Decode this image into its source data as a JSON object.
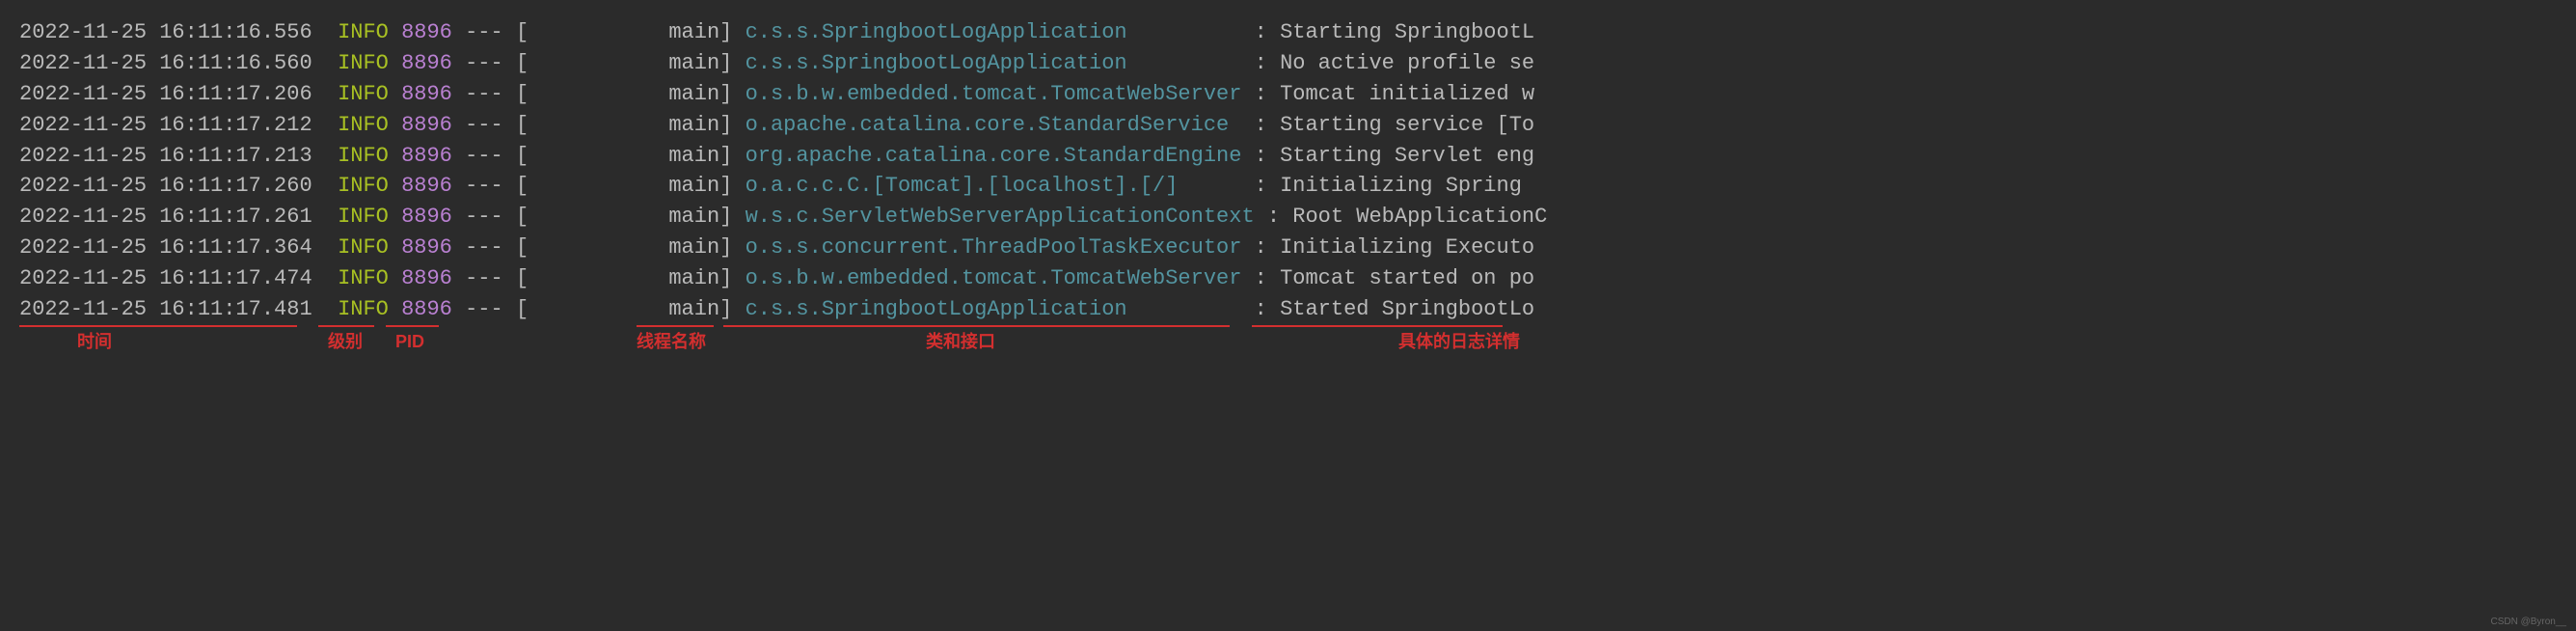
{
  "logs": [
    {
      "timestamp": "2022-11-25 16:11:16.556",
      "level": "INFO",
      "pid": "8896",
      "sep": "---",
      "thread": "main",
      "logger": "c.s.s.SpringbootLogApplication         ",
      "message": "Starting SpringbootL"
    },
    {
      "timestamp": "2022-11-25 16:11:16.560",
      "level": "INFO",
      "pid": "8896",
      "sep": "---",
      "thread": "main",
      "logger": "c.s.s.SpringbootLogApplication         ",
      "message": "No active profile se"
    },
    {
      "timestamp": "2022-11-25 16:11:17.206",
      "level": "INFO",
      "pid": "8896",
      "sep": "---",
      "thread": "main",
      "logger": "o.s.b.w.embedded.tomcat.TomcatWebServer",
      "message": "Tomcat initialized w"
    },
    {
      "timestamp": "2022-11-25 16:11:17.212",
      "level": "INFO",
      "pid": "8896",
      "sep": "---",
      "thread": "main",
      "logger": "o.apache.catalina.core.StandardService ",
      "message": "Starting service [To"
    },
    {
      "timestamp": "2022-11-25 16:11:17.213",
      "level": "INFO",
      "pid": "8896",
      "sep": "---",
      "thread": "main",
      "logger": "org.apache.catalina.core.StandardEngine",
      "message": "Starting Servlet eng"
    },
    {
      "timestamp": "2022-11-25 16:11:17.260",
      "level": "INFO",
      "pid": "8896",
      "sep": "---",
      "thread": "main",
      "logger": "o.a.c.c.C.[Tomcat].[localhost].[/]     ",
      "message": "Initializing Spring "
    },
    {
      "timestamp": "2022-11-25 16:11:17.261",
      "level": "INFO",
      "pid": "8896",
      "sep": "---",
      "thread": "main",
      "logger": "w.s.c.ServletWebServerApplicationContext",
      "message": "Root WebApplicationC"
    },
    {
      "timestamp": "2022-11-25 16:11:17.364",
      "level": "INFO",
      "pid": "8896",
      "sep": "---",
      "thread": "main",
      "logger": "o.s.s.concurrent.ThreadPoolTaskExecutor",
      "message": "Initializing Executo"
    },
    {
      "timestamp": "2022-11-25 16:11:17.474",
      "level": "INFO",
      "pid": "8896",
      "sep": "---",
      "thread": "main",
      "logger": "o.s.b.w.embedded.tomcat.TomcatWebServer",
      "message": "Tomcat started on po"
    },
    {
      "timestamp": "2022-11-25 16:11:17.481",
      "level": "INFO",
      "pid": "8896",
      "sep": "---",
      "thread": "main",
      "logger": "c.s.s.SpringbootLogApplication         ",
      "message": "Started SpringbootLo"
    }
  ],
  "annotations": {
    "time": "时间",
    "level": "级别",
    "pid": "PID",
    "thread": "线程名称",
    "logger": "类和接口",
    "message": "具体的日志详情"
  },
  "watermark": "CSDN @Byron__"
}
